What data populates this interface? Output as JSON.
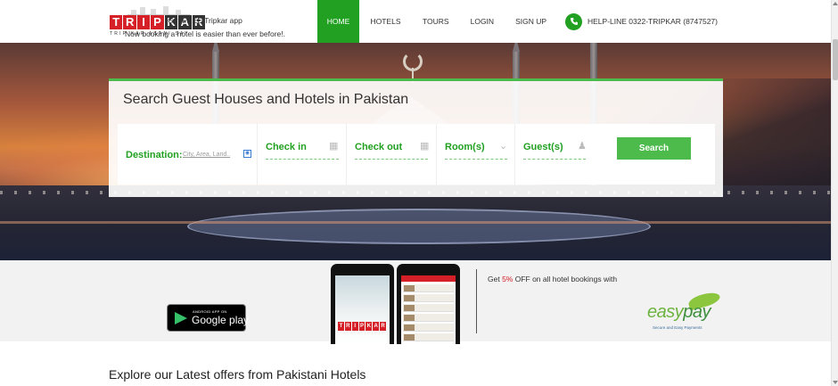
{
  "header": {
    "logo_letters": [
      "T",
      "R",
      "I",
      "P",
      "K",
      "A",
      "R"
    ],
    "logo_tagline": "TRIP KAR ASANI SAY",
    "nav": [
      {
        "label": "HOME"
      },
      {
        "label": "HOTELS"
      },
      {
        "label": "TOURS"
      },
      {
        "label": "LOGIN"
      },
      {
        "label": "SIGN UP"
      }
    ],
    "helpline": "HELP-LINE 0322-TRIPKAR (8747527)"
  },
  "search": {
    "title": "Search Guest Houses and Hotels in Pakistan",
    "destination_label": "Destination:",
    "destination_placeholder": "City, Area, Land..",
    "checkin_label": "Check in",
    "checkout_label": "Check out",
    "rooms_label": "Room(s)",
    "guests_label": "Guest(s)",
    "button_label": "Search"
  },
  "app_promo": {
    "line1": "Get FREE Tripkar app",
    "line2": "Now booking a hotel is easier than ever before!.",
    "store_small": "ANDROID APP ON",
    "store_big": "Google play"
  },
  "offer": {
    "prefix": "Get ",
    "percent": "5%",
    "suffix": " OFF on all hotel bookings with",
    "brand_e": "easy",
    "brand_rest": "pay",
    "brand_sub": "Secure and Easy Payments"
  },
  "offers_section": {
    "title": "Explore our Latest offers from Pakistani Hotels"
  },
  "colors": {
    "accent": "#22a021",
    "brand_red": "#d62027"
  }
}
